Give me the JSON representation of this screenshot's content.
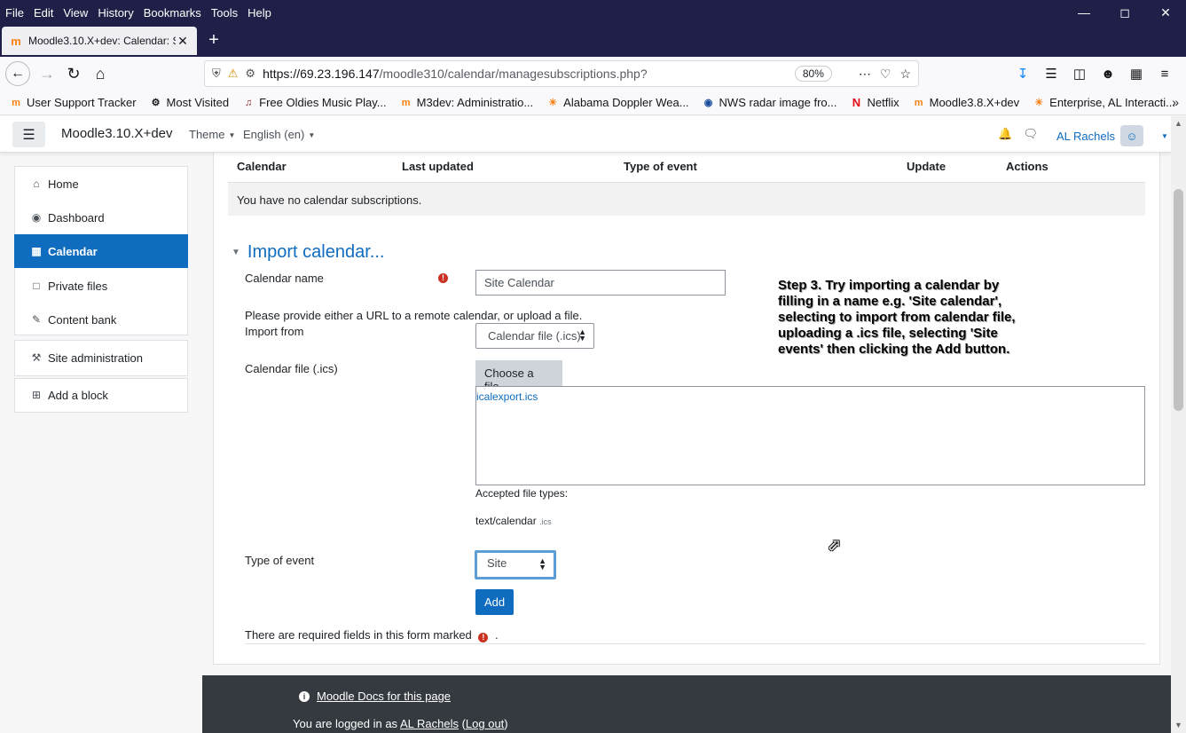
{
  "browser": {
    "menu": [
      "File",
      "Edit",
      "View",
      "History",
      "Bookmarks",
      "Tools",
      "Help"
    ],
    "tab_title": "Moodle3.10.X+dev: Calendar: S",
    "url_host": "https://69.23.196.147",
    "url_path": "/moodle310/calendar/managesubscriptions.php?",
    "zoom": "80%",
    "bookmarks": [
      {
        "label": "User Support Tracker",
        "icon": "moodle-icon"
      },
      {
        "label": "Most Visited",
        "icon": "gear-icon"
      },
      {
        "label": "Free Oldies Music Play...",
        "icon": "music-icon"
      },
      {
        "label": "M3dev: Administratio...",
        "icon": "moodle-icon"
      },
      {
        "label": "Alabama Doppler Wea...",
        "icon": "weather-icon"
      },
      {
        "label": "NWS radar image fro...",
        "icon": "nws-icon"
      },
      {
        "label": "Netflix",
        "icon": "netflix-icon"
      },
      {
        "label": "Moodle3.8.X+dev",
        "icon": "moodle-icon"
      },
      {
        "label": "Enterprise, AL Interacti...",
        "icon": "weather-icon"
      }
    ]
  },
  "header": {
    "site_name": "Moodle3.10.X+dev",
    "theme_menu": "Theme",
    "language_menu": "English (en)",
    "user_name": "AL Rachels"
  },
  "sidebar": {
    "items": [
      {
        "label": "Home",
        "icon": "home-icon"
      },
      {
        "label": "Dashboard",
        "icon": "dashboard-icon"
      },
      {
        "label": "Calendar",
        "icon": "calendar-icon",
        "active": true
      },
      {
        "label": "Private files",
        "icon": "file-icon"
      },
      {
        "label": "Content bank",
        "icon": "brush-icon"
      },
      {
        "label": "Site administration",
        "icon": "wrench-icon"
      },
      {
        "label": "Add a block",
        "icon": "plus-square-icon"
      }
    ]
  },
  "subscriptions": {
    "columns": [
      "Calendar",
      "Last updated",
      "Type of event",
      "Update",
      "Actions"
    ],
    "empty_message": "You have no calendar subscriptions."
  },
  "import_form": {
    "legend": "Import calendar...",
    "calendar_name_label": "Calendar name",
    "calendar_name_value": "Site Calendar",
    "help_text": "Please provide either a URL to a remote calendar, or upload a file.",
    "import_from_label": "Import from",
    "import_from_value": "Calendar file (.ics)",
    "file_label": "Calendar file (.ics)",
    "choose_file_button": "Choose a file...",
    "uploaded_file": "icalexport.ics",
    "accepted_types_label": "Accepted file types:",
    "accepted_type": "text/calendar",
    "accepted_ext": ".ics",
    "type_of_event_label": "Type of event",
    "type_of_event_value": "Site",
    "add_button": "Add",
    "required_note_before": "There are required fields in this form marked",
    "required_note_after": "."
  },
  "annotation": {
    "text": "Step  3. Try importing a calendar by filling in a name e.g. 'Site calendar', selecting to import from calendar file, uploading a .ics file, selecting 'Site events' then clicking the Add button."
  },
  "footer": {
    "docs_link": "Moodle Docs for this page",
    "logged_in_prefix": "You are logged in as",
    "user_link": "AL Rachels",
    "logout_link": "Log out"
  },
  "colors": {
    "primary": "#0f6cbf",
    "browser_chrome": "#1f1f47",
    "footer": "#343a40",
    "required": "#ca3120"
  }
}
